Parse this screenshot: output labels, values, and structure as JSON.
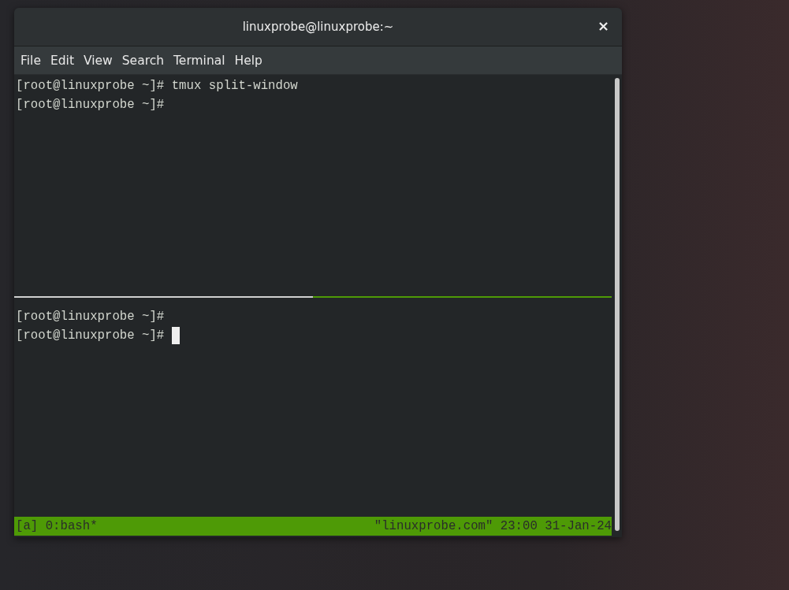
{
  "window": {
    "title": "linuxprobe@linuxprobe:~",
    "close": "×"
  },
  "menu": [
    {
      "label": "File"
    },
    {
      "label": "Edit"
    },
    {
      "label": "View"
    },
    {
      "label": "Search"
    },
    {
      "label": "Terminal"
    },
    {
      "label": "Help"
    }
  ],
  "panes": [
    {
      "active": false,
      "lines": [
        {
          "text": "[root@linuxprobe ~]# tmux split-window",
          "cursor": false
        },
        {
          "text": "[root@linuxprobe ~]#",
          "cursor": false
        }
      ]
    },
    {
      "active": true,
      "lines": [
        {
          "text": "[root@linuxprobe ~]#",
          "cursor": false
        },
        {
          "text": "[root@linuxprobe ~]# ",
          "cursor": true
        }
      ]
    }
  ],
  "status_bar": {
    "left": "[a] 0:bash*",
    "right": "\"linuxprobe.com\" 23:00 31-Jan-24"
  }
}
